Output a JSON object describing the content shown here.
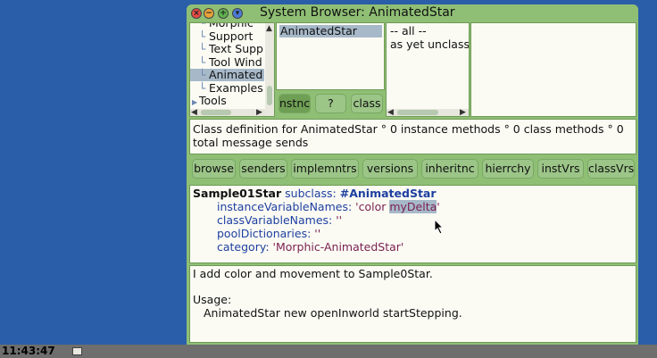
{
  "window": {
    "title": "System Browser: AnimatedStar"
  },
  "categories": {
    "items": [
      {
        "label": "Morphic",
        "selected": false,
        "indent": 1
      },
      {
        "label": "Support",
        "selected": false,
        "indent": 1
      },
      {
        "label": "Text Supp",
        "selected": false,
        "indent": 1
      },
      {
        "label": "Tool Wind",
        "selected": false,
        "indent": 1
      },
      {
        "label": "Animated",
        "selected": true,
        "indent": 1
      },
      {
        "label": "Examples",
        "selected": false,
        "indent": 1
      },
      {
        "label": "Tools",
        "selected": false,
        "indent": 0
      }
    ]
  },
  "classes": {
    "items": [
      "AnimatedStar"
    ]
  },
  "protocols": {
    "items": [
      "-- all --",
      "as yet unclass"
    ]
  },
  "class_buttons": {
    "instance": "nstnc",
    "help": "?",
    "class": "class"
  },
  "info": {
    "text": "Class definition for AnimatedStar ° 0 instance methods ° 0 class methods ° 0 total message sends"
  },
  "toolbar": [
    "browse",
    "senders",
    "implemntrs",
    "versions",
    "inheritnc",
    "hierrchy",
    "instVrs",
    "classVrs"
  ],
  "code": {
    "superclass": "Sample01Star",
    "subclass_kw": "subclass:",
    "class_symbol": "#AnimatedStar",
    "ivar_kw": "instanceVariableNames:",
    "ivar_open": "'color ",
    "ivar_selected": "myDelta",
    "ivar_close": "'",
    "cvar_kw": "classVariableNames:",
    "cvar_val": "''",
    "pool_kw": "poolDictionaries:",
    "pool_val": "''",
    "cat_kw": "category:",
    "cat_val": "'Morphic-AnimatedStar'"
  },
  "comment": {
    "line1": "I add color and movement to Sample0Star.",
    "line2": "Usage:",
    "line3": "AnimatedStar new openInworld startStepping."
  },
  "taskbar": {
    "clock": "11:43:47"
  },
  "colors": {
    "desktop": "#2a5ea8",
    "window": "#8fbf74",
    "selection": "#a7b9c9"
  }
}
